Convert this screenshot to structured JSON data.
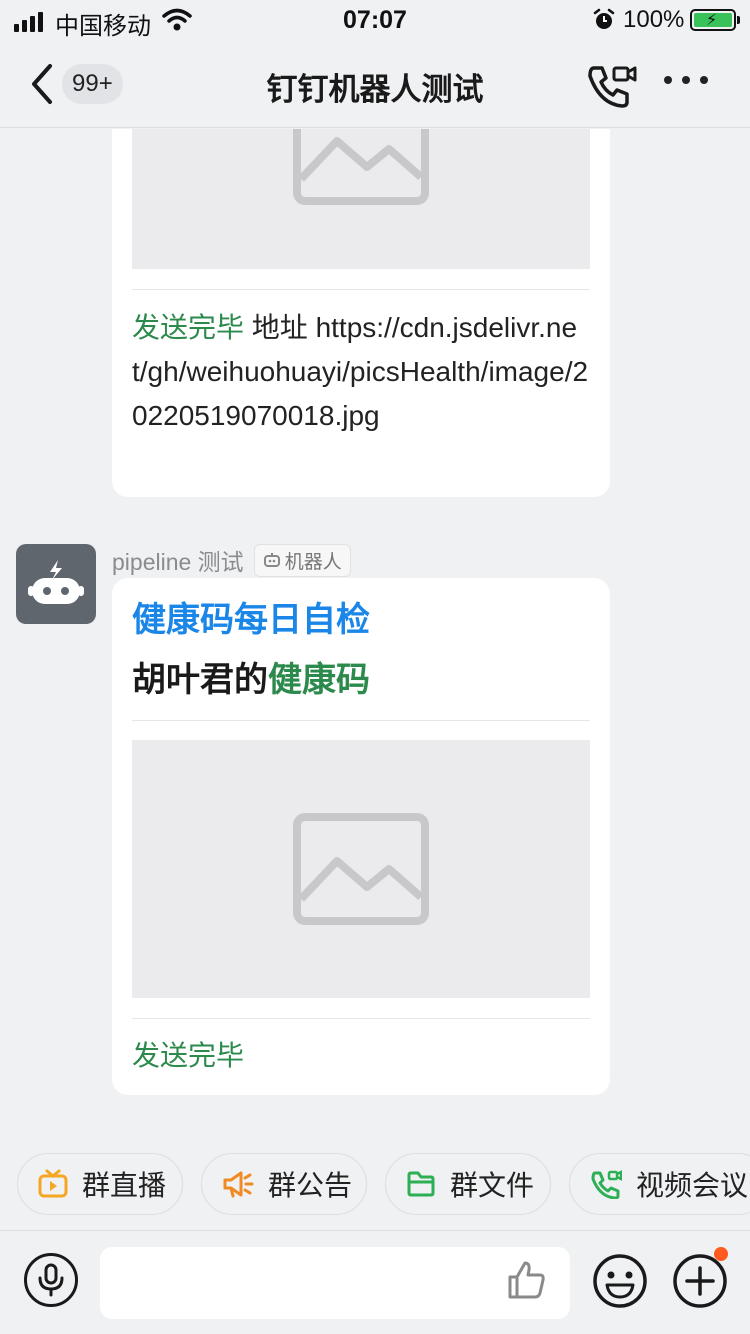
{
  "status_bar": {
    "carrier": "中国移动",
    "time": "07:07",
    "battery": "100%"
  },
  "nav": {
    "unread_badge": "99+",
    "title": "钉钉机器人测试",
    "icons": [
      "chevron-left-icon",
      "video-call-icon",
      "more-icon"
    ]
  },
  "messages": [
    {
      "status": "发送完毕",
      "text": " 地址 https://cdn.jsdelivr.net/gh/weihuohuayi/picsHealth/image/20220519070018.jpg"
    },
    {
      "sender": "pipeline 测试",
      "sender_tag": "机器人",
      "title": "健康码每日自检",
      "subtitle_prefix": "胡叶君的",
      "subtitle_highlight": "健康码",
      "status": "发送完毕"
    }
  ],
  "quick_actions": [
    {
      "label": "群直播",
      "icon": "tv-icon",
      "color": "#f5a623"
    },
    {
      "label": "群公告",
      "icon": "megaphone-icon",
      "color": "#f08a24"
    },
    {
      "label": "群文件",
      "icon": "folder-icon",
      "color": "#2db055"
    },
    {
      "label": "视频会议",
      "icon": "video-call-icon",
      "color": "#2db055"
    }
  ],
  "input": {
    "placeholder": ""
  },
  "colors": {
    "status_green": "#2c8a4d",
    "link_blue": "#1a86e8",
    "background": "#f0f1f3"
  }
}
